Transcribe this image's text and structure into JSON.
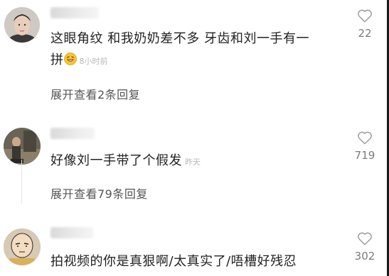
{
  "comments": [
    {
      "text_line1": "这眼角纹  和我奶奶差不多  牙齿和刘一手有一",
      "text_line2": "拼",
      "emoji": "laughing-emoji",
      "time": "8小时前",
      "replies": "展开查看2条回复",
      "likes": "22"
    },
    {
      "text_line1": "好像刘一手带了个假发",
      "time": "昨天",
      "replies": "展开查看79条回复",
      "likes": "719"
    },
    {
      "text_line1": "拍视频的你是真狠啊/太真实了/唔槽好残忍",
      "likes": "302"
    }
  ],
  "icons": {
    "like": "heart-outline-icon"
  },
  "colors": {
    "text": "#222222",
    "secondary": "#555555",
    "timestamp": "#b9b9b9",
    "like_count": "#7b7b7b"
  }
}
